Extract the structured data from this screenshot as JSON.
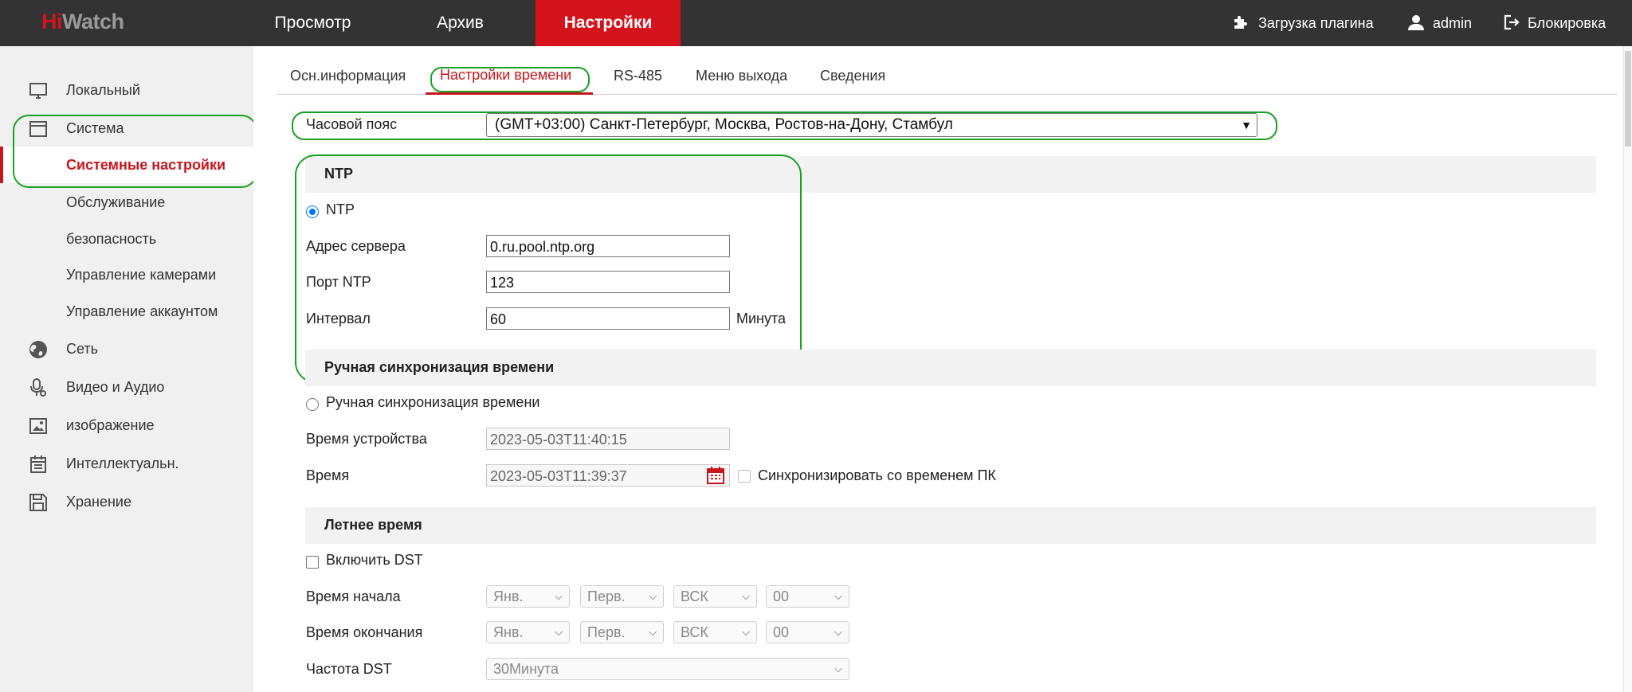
{
  "brand": {
    "logo_prefix": "Hi",
    "logo_suffix": "Watch"
  },
  "nav": {
    "items": [
      {
        "label": "Просмотр"
      },
      {
        "label": "Архив"
      },
      {
        "label": "Настройки"
      }
    ],
    "active": "Настройки"
  },
  "topright": {
    "plugin": "Загрузка плагина",
    "user": "admin",
    "lock": "Блокировка"
  },
  "sidebar": {
    "items": [
      {
        "label": "Локальный",
        "icon": "monitor-icon"
      },
      {
        "label": "Система",
        "icon": "window-icon"
      },
      {
        "label": "Системные настройки"
      },
      {
        "label": "Обслуживание"
      },
      {
        "label": "безопасность"
      },
      {
        "label": "Управление камерами"
      },
      {
        "label": "Управление аккаунтом"
      },
      {
        "label": "Сеть",
        "icon": "globe-icon"
      },
      {
        "label": "Видео и Аудио",
        "icon": "microphone-icon"
      },
      {
        "label": "изображение",
        "icon": "image-icon"
      },
      {
        "label": "Интеллектуальн.",
        "icon": "calendar-icon"
      },
      {
        "label": "Хранение",
        "icon": "floppy-icon"
      }
    ],
    "selected": "Системные настройки"
  },
  "tabs": [
    {
      "label": "Осн.информация"
    },
    {
      "label": "Настройки времени"
    },
    {
      "label": "RS-485"
    },
    {
      "label": "Меню выхода"
    },
    {
      "label": "Сведения"
    }
  ],
  "active_tab": "Настройки времени",
  "timezone": {
    "label": "Часовой пояс",
    "value": "(GMT+03:00) Санкт-Петербург, Москва, Ростов-на-Дону, Стамбул"
  },
  "ntp": {
    "section_title": "NTP",
    "radio_label": "NTP",
    "selected": true,
    "server_label": "Адрес сервера",
    "server_value": "0.ru.pool.ntp.org",
    "port_label": "Порт NTP",
    "port_value": "123",
    "interval_label": "Интервал",
    "interval_value": "60",
    "interval_unit": "Минута"
  },
  "manual": {
    "section_title": "Ручная синхронизация времени",
    "radio_label": "Ручная синхронизация времени",
    "device_time_label": "Время устройства",
    "device_time_value": "2023-05-03T11:40:15",
    "time_label": "Время",
    "time_value": "2023-05-03T11:39:37",
    "sync_pc_label": "Синхронизировать со временем ПК"
  },
  "dst": {
    "section_title": "Летнее время",
    "enable_label": "Включить DST",
    "start_label": "Время начала",
    "end_label": "Время окончания",
    "freq_label": "Частота DST",
    "start_values": [
      "Янв.",
      "Перв.",
      "ВСК",
      "00"
    ],
    "end_values": [
      "Янв.",
      "Перв.",
      "ВСК",
      "00"
    ],
    "freq_value": "30Минута"
  },
  "colors": {
    "accent": "#d4141d",
    "topbar": "#333333",
    "highlight": "#18a21f",
    "radio": "#0075ff"
  }
}
